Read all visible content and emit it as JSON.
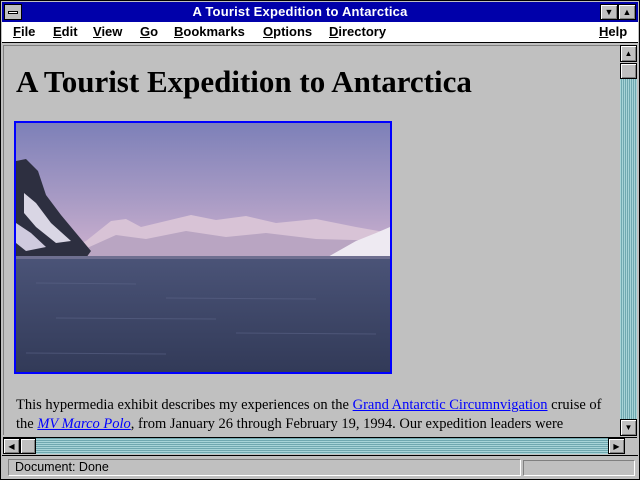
{
  "window": {
    "title": "A Tourist Expedition to Antarctica"
  },
  "menu": {
    "items": [
      {
        "first": "F",
        "rest": "ile"
      },
      {
        "first": "E",
        "rest": "dit"
      },
      {
        "first": "V",
        "rest": "iew"
      },
      {
        "first": "G",
        "rest": "o"
      },
      {
        "first": "B",
        "rest": "ookmarks"
      },
      {
        "first": "O",
        "rest": "ptions"
      },
      {
        "first": "D",
        "rest": "irectory"
      }
    ],
    "help": {
      "first": "H",
      "rest": "elp"
    }
  },
  "content": {
    "heading": "A Tourist Expedition to Antarctica",
    "paragraph": {
      "t1": "This hypermedia exhibit describes my experiences on the ",
      "link1": "Grand Antarctic Circumnvigation",
      "t2": " cruise of the ",
      "link2": "MV Marco Polo",
      "t3": ", from January 26 through February 19, 1994. Our expedition leaders were"
    }
  },
  "status": {
    "text": "Document: Done"
  },
  "icons": {
    "system_menu": "system-menu-icon",
    "minimize": "minimize-icon",
    "maximize": "maximize-icon",
    "scroll_up": "arrow-up-icon",
    "scroll_down": "arrow-down-icon",
    "scroll_left": "arrow-left-icon",
    "scroll_right": "arrow-right-icon"
  },
  "colors": {
    "title_bar": "#0000aa",
    "link": "#0000ff",
    "background": "#c0c0c0",
    "scrollbar_track": "#8ac0c8"
  }
}
